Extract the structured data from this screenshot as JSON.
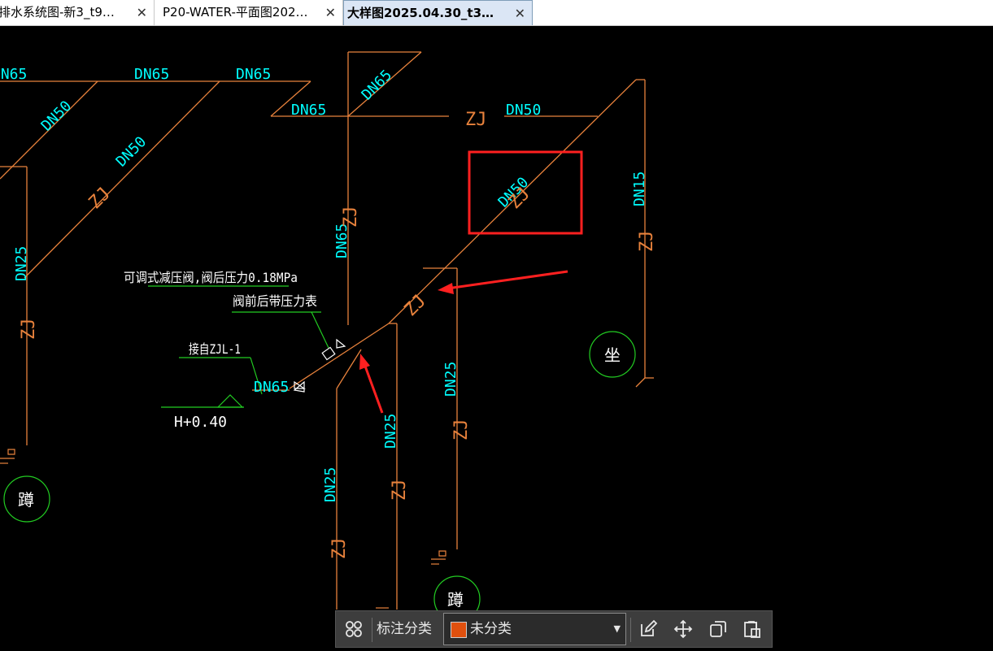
{
  "tabs": [
    {
      "label": "排水系统图-新3_t9…",
      "close": "✕"
    },
    {
      "label": "P20-WATER-平面图202…",
      "close": "✕"
    },
    {
      "label": "大样图2025.04.30_t3…",
      "close": "✕"
    }
  ],
  "drawing": {
    "dn65": "DN65",
    "dn50": "DN50",
    "dn25": "DN25",
    "dn15": "DN15",
    "zj": "ZJ",
    "valve_note": "可调式减压阀,阀后压力0.18MPa",
    "gauge_note": "阀前后带压力表",
    "source_note": "接自ZJL-1",
    "elevation": "H+0.40",
    "fixture_squat": "蹲",
    "fixture_seat": "坐"
  },
  "colors": {
    "pipe": "#e8823c",
    "label": "#00ffff",
    "annotation": "#ffffff",
    "leader": "#22cc22",
    "highlight": "#ff2020"
  },
  "toolbar": {
    "label": "标注分类",
    "select_value": "未分类",
    "swatch_color": "#e0500e"
  }
}
